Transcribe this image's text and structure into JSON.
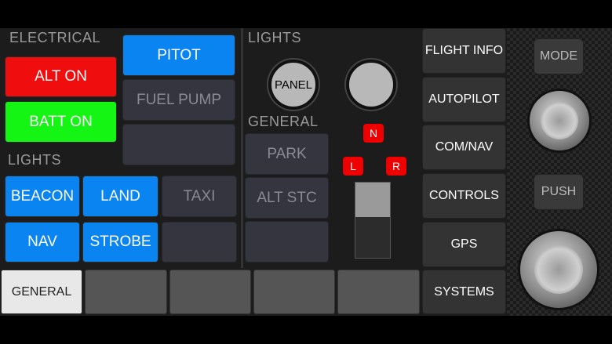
{
  "electrical": {
    "heading": "ELECTRICAL",
    "alt_on": "ALT ON",
    "batt_on": "BATT ON"
  },
  "col2": {
    "pitot": "PITOT",
    "fuel_pump": "FUEL PUMP"
  },
  "lights_left": {
    "heading": "LIGHTS",
    "beacon": "BEACON",
    "land": "LAND",
    "taxi": "TAXI",
    "nav": "NAV",
    "strobe": "STROBE"
  },
  "lights_mid": {
    "heading": "LIGHTS",
    "panel": "PANEL"
  },
  "general": {
    "heading": "GENERAL",
    "park": "PARK",
    "alt_stc": "ALT STC"
  },
  "gear": {
    "n": "N",
    "l": "L",
    "r": "R"
  },
  "side_nav": [
    "FLIGHT INFO",
    "AUTOPILOT",
    "COM/NAV",
    "CONTROLS",
    "GPS",
    "SYSTEMS"
  ],
  "side_nav_active": "CONTROLS",
  "bottom_tabs": {
    "general": "GENERAL"
  },
  "knobs": {
    "mode": "MODE",
    "push": "PUSH"
  },
  "colors": {
    "blue": "#0a84f0",
    "red": "#f00d0d",
    "green": "#14f514"
  }
}
